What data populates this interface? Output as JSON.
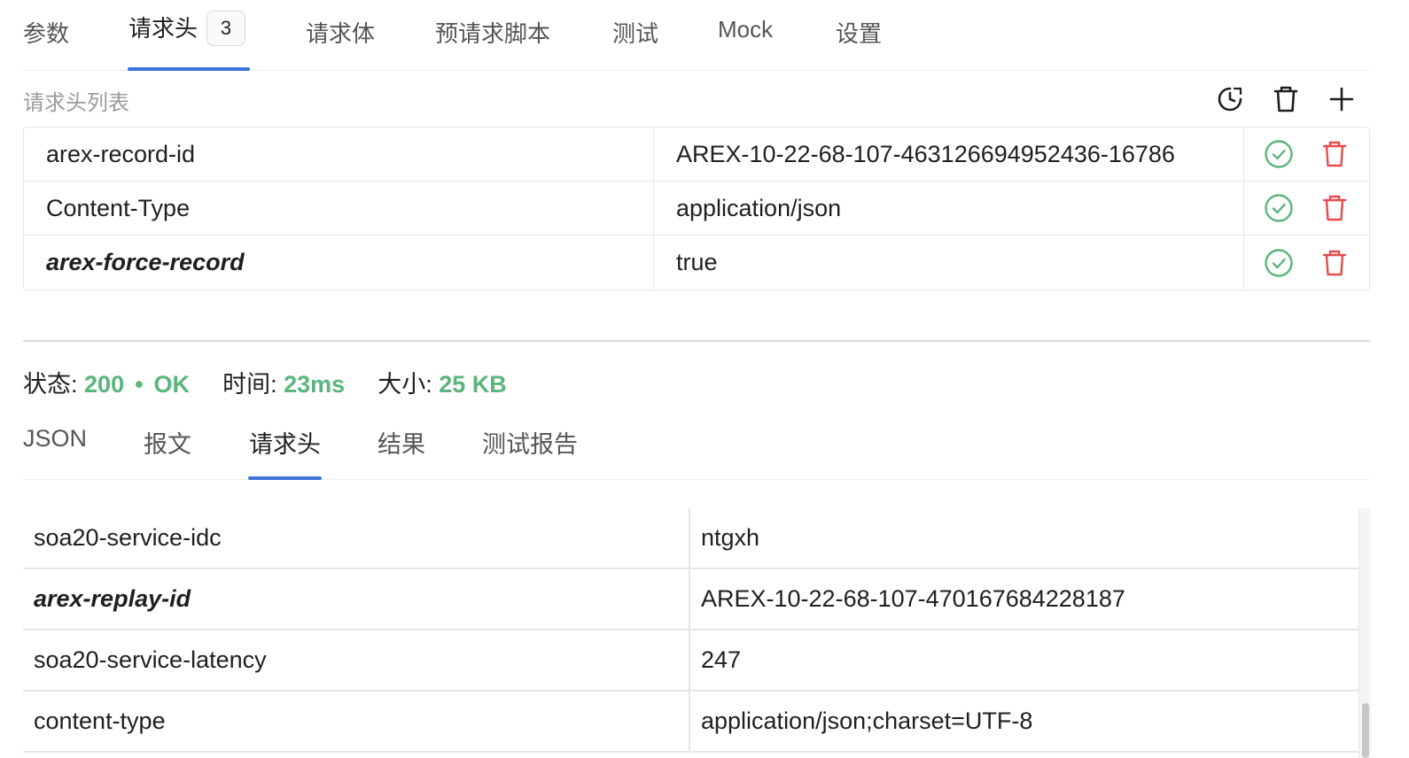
{
  "request_tabs": [
    {
      "label": "参数"
    },
    {
      "label": "请求头",
      "badge": "3",
      "active": true
    },
    {
      "label": "请求体"
    },
    {
      "label": "预请求脚本"
    },
    {
      "label": "测试"
    },
    {
      "label": "Mock"
    },
    {
      "label": "设置"
    }
  ],
  "header_list": {
    "title": "请求头列表",
    "toolbar_icons": [
      "history-icon",
      "trash-icon",
      "plus-icon"
    ],
    "rows": [
      {
        "key": "arex-record-id",
        "value": "AREX-10-22-68-107-463126694952436-16786",
        "enabled": true
      },
      {
        "key": "Content-Type",
        "value": "application/json",
        "enabled": true
      },
      {
        "key": "arex-force-record",
        "value": "true",
        "enabled": true,
        "emphasized": true
      }
    ],
    "colors": {
      "check": "#5bb57c",
      "delete": "#e34d4d"
    }
  },
  "response": {
    "status_label": "状态:",
    "status_code": "200",
    "status_dot": "•",
    "status_text": "OK",
    "time_label": "时间:",
    "time_value": "23ms",
    "size_label": "大小:",
    "size_value": "25 KB",
    "value_color": "#5bb57c",
    "tabs": [
      {
        "label": "JSON"
      },
      {
        "label": "报文"
      },
      {
        "label": "请求头",
        "active": true
      },
      {
        "label": "结果"
      },
      {
        "label": "测试报告"
      }
    ],
    "headers": [
      {
        "key": "soa20-service-idc",
        "value": "ntgxh"
      },
      {
        "key": "arex-replay-id",
        "value": "AREX-10-22-68-107-470167684228187",
        "emphasized": true
      },
      {
        "key": "soa20-service-latency",
        "value": "247"
      },
      {
        "key": "content-type",
        "value": "application/json;charset=UTF-8"
      }
    ]
  },
  "accent_color": "#3b73d9"
}
